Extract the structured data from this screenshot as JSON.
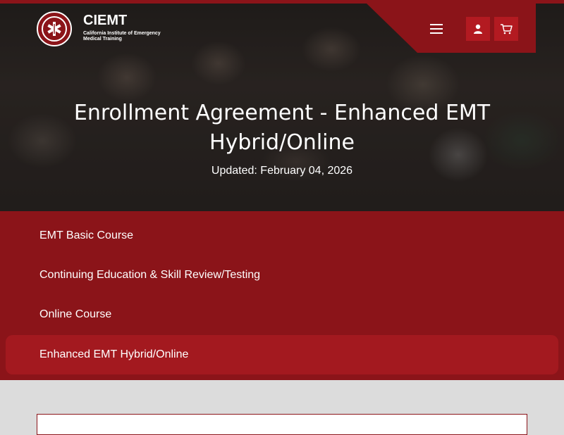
{
  "header": {
    "brand_name": "CIEMT",
    "brand_sub": "California Institute of Emergency Medical Training",
    "icons": [
      "star-of-life-icon",
      "hamburger-menu-icon",
      "user-icon",
      "cart-icon"
    ]
  },
  "hero": {
    "title": "Enrollment Agreement - Enhanced EMT Hybrid/Online",
    "updated": "Updated: February 04, 2026"
  },
  "menu": {
    "items": [
      {
        "label": "EMT Basic Course"
      },
      {
        "label": "Continuing Education & Skill Review/Testing"
      },
      {
        "label": "Online Course"
      },
      {
        "label": "Enhanced EMT Hybrid/Online"
      }
    ],
    "active_index": 3
  },
  "colors": {
    "brand": "#8b1419",
    "active": "#a3191f",
    "button": "#b31a21",
    "page_bg": "#dcdcdc"
  }
}
